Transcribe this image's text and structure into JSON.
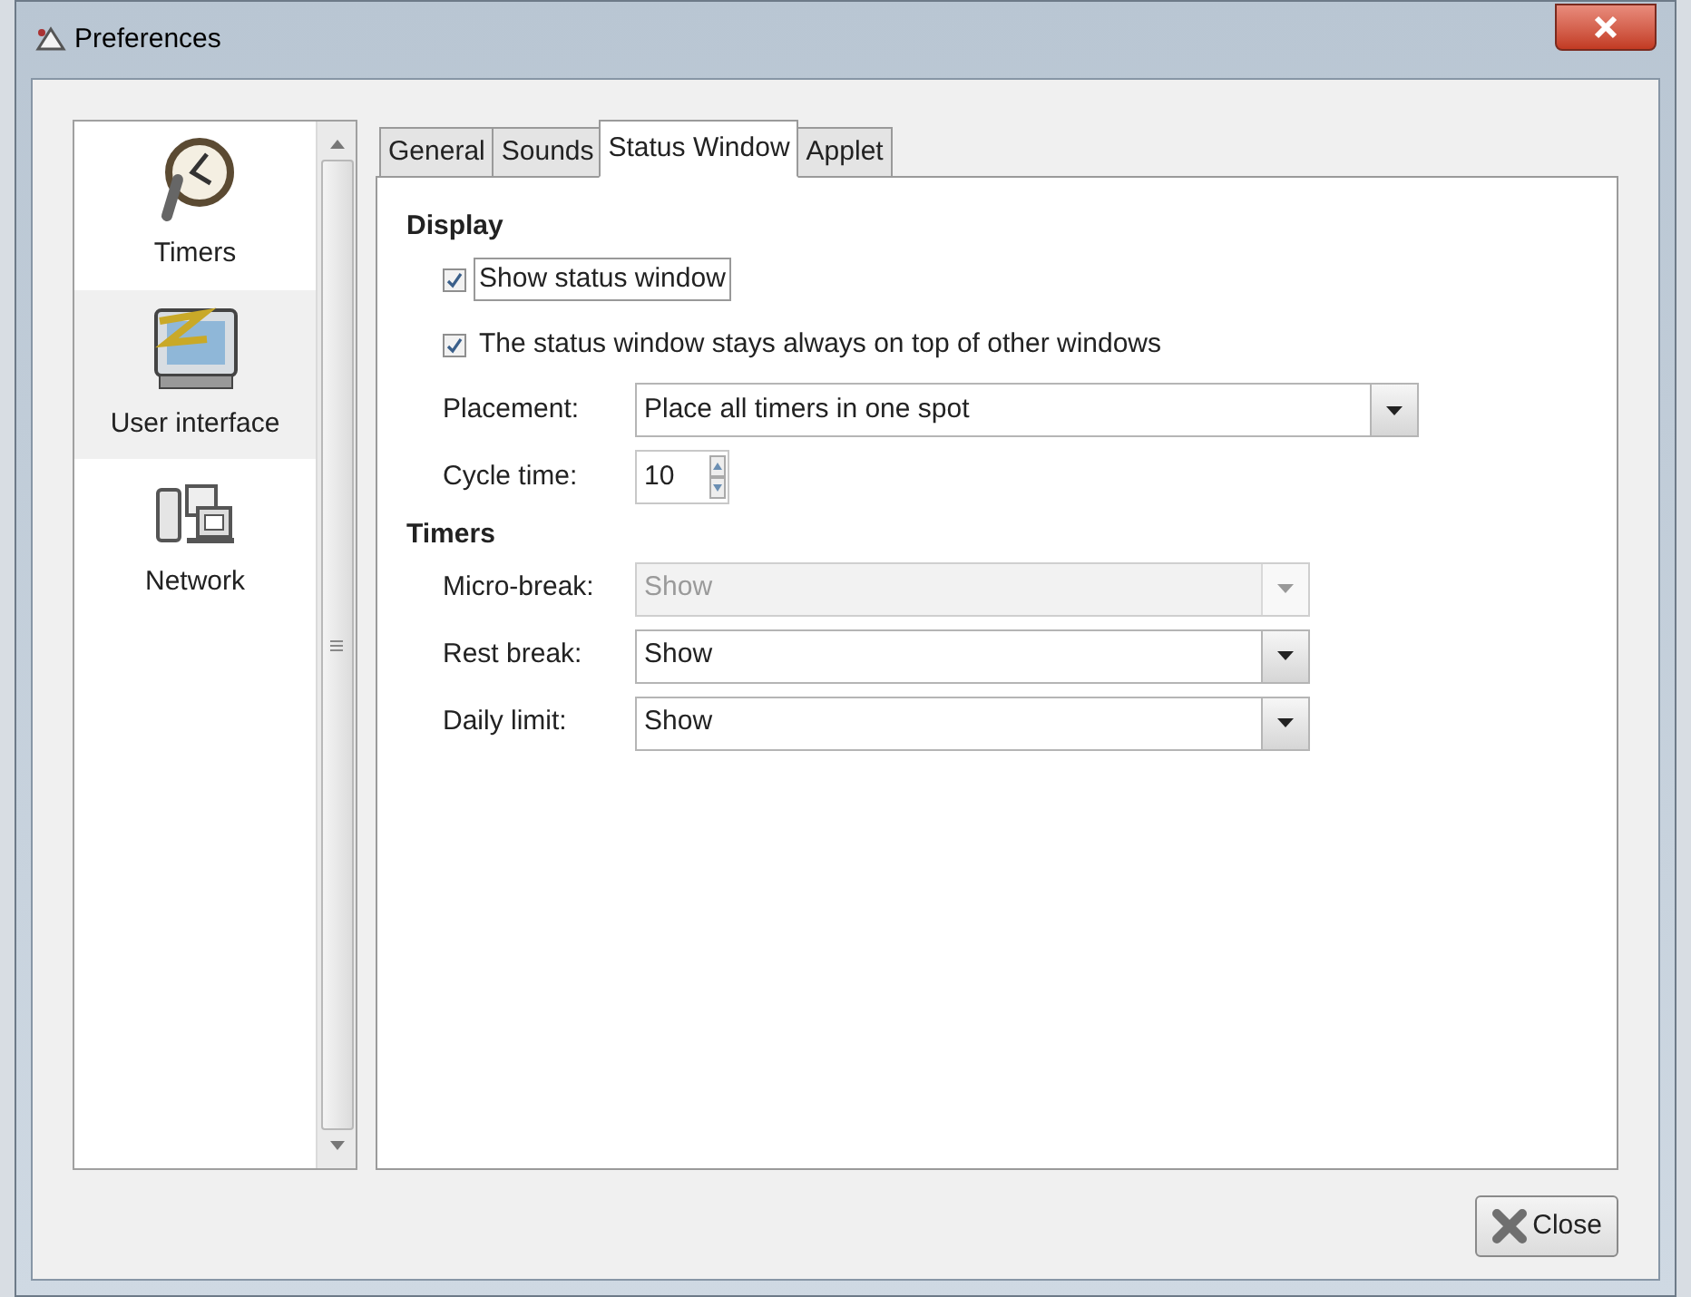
{
  "window": {
    "title": "Preferences"
  },
  "sidebar": {
    "items": [
      {
        "label": "Timers",
        "selected": false
      },
      {
        "label": "User interface",
        "selected": true
      },
      {
        "label": "Network",
        "selected": false
      }
    ]
  },
  "tabs": [
    {
      "label": "General",
      "selected": false
    },
    {
      "label": "Sounds",
      "selected": false
    },
    {
      "label": "Status Window",
      "selected": true
    },
    {
      "label": "Applet",
      "selected": false
    }
  ],
  "display": {
    "heading": "Display",
    "checkboxes": [
      {
        "label": "Show status window",
        "checked": true,
        "focused": true
      },
      {
        "label": "The status window stays always on top of other windows",
        "checked": true,
        "focused": false
      }
    ],
    "placement": {
      "label": "Placement:",
      "value": "Place all timers in one spot"
    },
    "cycle_time": {
      "label": "Cycle time:",
      "value": "10"
    }
  },
  "timers": {
    "heading": "Timers",
    "rows": [
      {
        "label": "Micro-break:",
        "value": "Show",
        "disabled": true
      },
      {
        "label": "Rest break:",
        "value": "Show",
        "disabled": false
      },
      {
        "label": "Daily limit:",
        "value": "Show",
        "disabled": false
      }
    ]
  },
  "buttons": [
    {
      "label": "Close"
    }
  ]
}
